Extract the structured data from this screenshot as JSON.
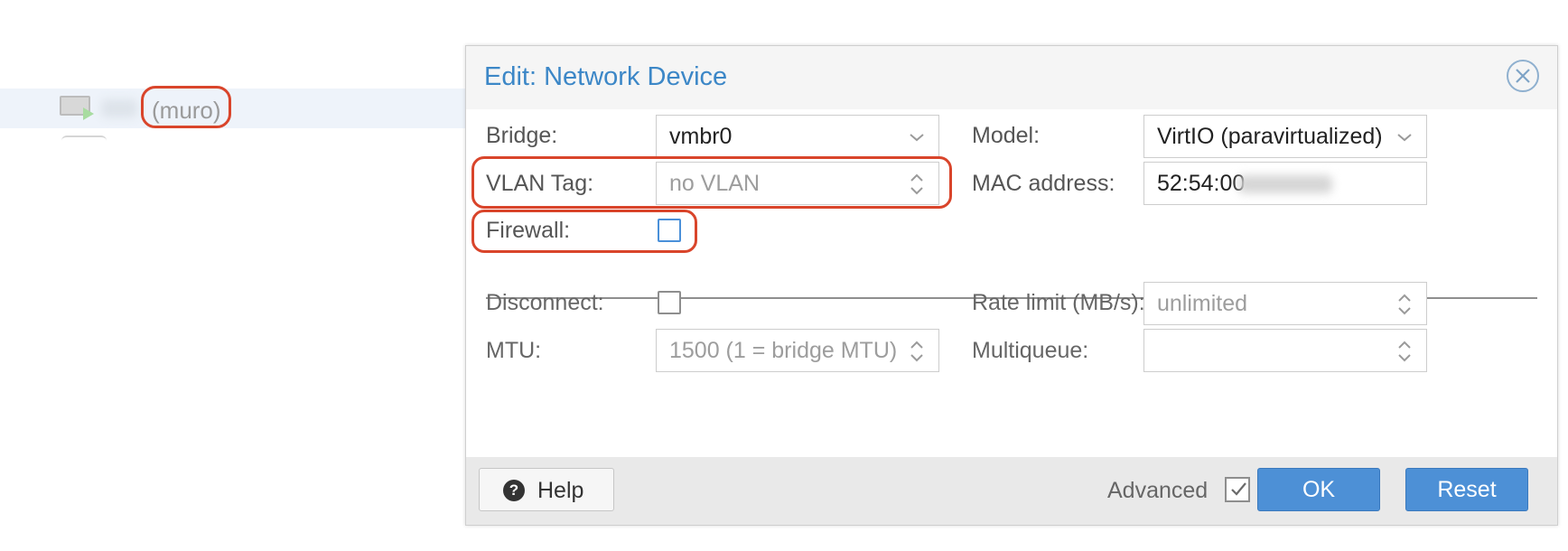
{
  "tree": {
    "vm_label": "(muro)"
  },
  "dialog": {
    "title": "Edit: Network Device",
    "fields": {
      "bridge": {
        "label": "Bridge:",
        "value": "vmbr0"
      },
      "model": {
        "label": "Model:",
        "value": "VirtIO (paravirtualized)"
      },
      "vlan_tag": {
        "label": "VLAN Tag:",
        "placeholder": "no VLAN"
      },
      "mac_address": {
        "label": "MAC address:",
        "value": "52:54:00"
      },
      "firewall": {
        "label": "Firewall:",
        "checked": false
      },
      "disconnect": {
        "label": "Disconnect:",
        "checked": false
      },
      "rate_limit": {
        "label": "Rate limit (MB/s):",
        "placeholder": "unlimited"
      },
      "mtu": {
        "label": "MTU:",
        "placeholder": "1500 (1 = bridge MTU)"
      },
      "multiqueue": {
        "label": "Multiqueue:",
        "value": ""
      }
    },
    "footer": {
      "help_label": "Help",
      "advanced_label": "Advanced",
      "advanced_checked": true,
      "ok_label": "OK",
      "reset_label": "Reset"
    }
  },
  "colors": {
    "accent": "#3c87c7",
    "button_blue": "#4d90d6",
    "highlight_ring": "#d9452b"
  }
}
